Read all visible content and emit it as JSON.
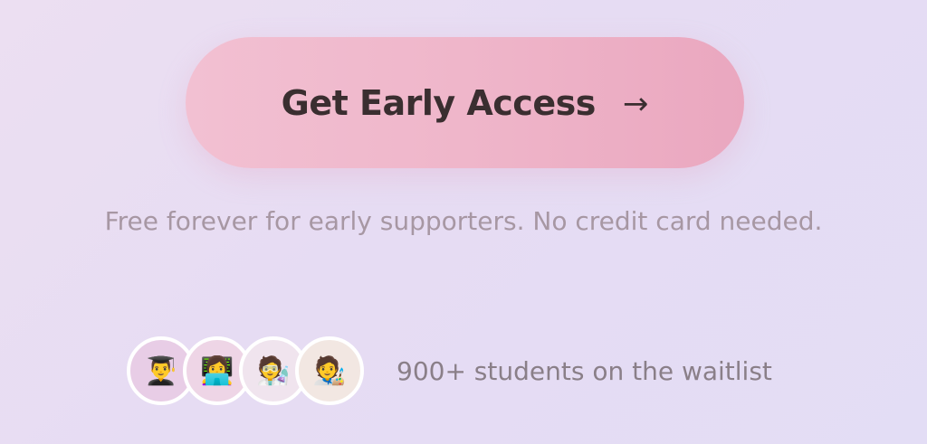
{
  "cta": {
    "label": "Get Early Access",
    "arrow": "→"
  },
  "note": "Free forever for early supporters. No credit card needed.",
  "waitlist": {
    "avatars": [
      {
        "icon": "👨‍🎓",
        "name": "graduate-avatar"
      },
      {
        "icon": "👩‍💻",
        "name": "laptop-avatar"
      },
      {
        "icon": "🧑‍🔬",
        "name": "scientist-avatar"
      },
      {
        "icon": "🧑‍🎨",
        "name": "artist-avatar"
      }
    ],
    "text": "900+ students on the waitlist"
  }
}
